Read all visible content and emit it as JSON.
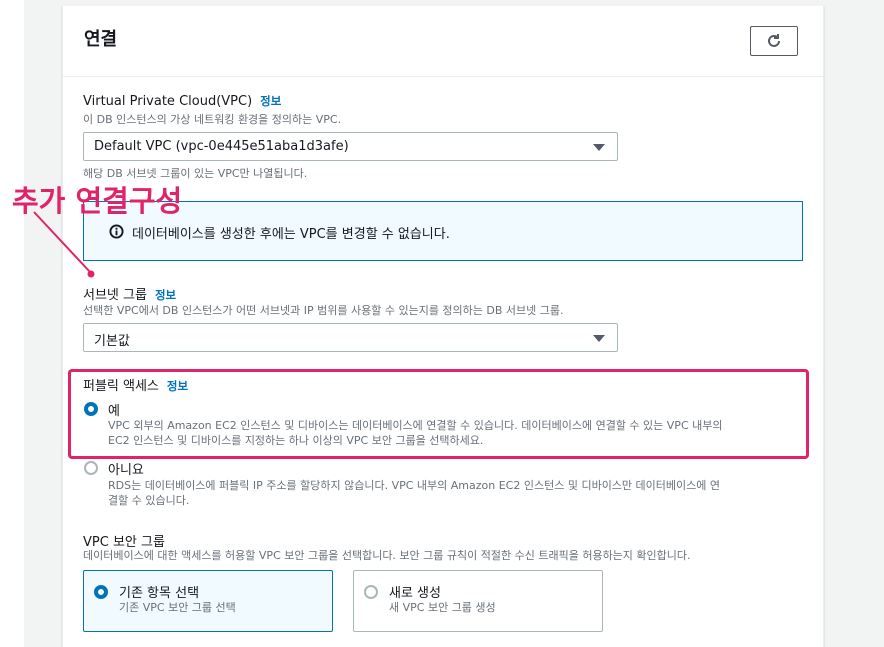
{
  "section": {
    "title": "연결",
    "refresh_icon": "refresh-icon"
  },
  "vpc": {
    "label": "Virtual Private Cloud(VPC)",
    "info": "정보",
    "description": "이 DB 인스턴스의 가상 네트워킹 환경을 정의하는 VPC.",
    "selected": "Default VPC (vpc-0e445e51aba1d3afe)",
    "hint": "해당 DB 서브넷 그룹이 있는 VPC만 나열됩니다."
  },
  "alert": {
    "icon": "info-icon",
    "text": "데이터베이스를 생성한 후에는 VPC를 변경할 수 없습니다."
  },
  "subnet": {
    "label": "서브넷 그룹",
    "info": "정보",
    "description": "선택한 VPC에서 DB 인스턴스가 어떤 서브넷과 IP 범위를 사용할 수 있는지를 정의하는 DB 서브넷 그룹.",
    "selected": "기본값"
  },
  "public_access": {
    "label": "퍼블릭 액세스",
    "info": "정보",
    "options": [
      {
        "title": "예",
        "description_line1": "VPC 외부의 Amazon EC2 인스턴스 및 디바이스는 데이터베이스에 연결할 수 있습니다. 데이터베이스에 연결할 수 있는 VPC 내부의",
        "description_line2": "EC2 인스턴스 및 디바이스를 지정하는 하나 이상의 VPC 보안 그룹을 선택하세요.",
        "checked": true
      },
      {
        "title": "아니요",
        "description_line1": "RDS는 데이터베이스에 퍼블릭 IP 주소를 할당하지 않습니다. VPC 내부의 Amazon EC2 인스턴스 및 디바이스만 데이터베이스에 연",
        "description_line2": "결할 수 있습니다.",
        "checked": false
      }
    ]
  },
  "security_group": {
    "label": "VPC 보안 그룹",
    "description": "데이터베이스에 대한 액세스를 허용할 VPC 보안 그룹을 선택합니다. 보안 그룹 규칙이 적절한 수신 트래픽을 허용하는지 확인합니다.",
    "options": [
      {
        "title": "기존 항목 선택",
        "subtitle": "기존 VPC 보안 그룹 선택",
        "checked": true
      },
      {
        "title": "새로 생성",
        "subtitle": "새 VPC 보안 그룹 생성",
        "checked": false
      }
    ]
  },
  "annotation": {
    "text": "추가 연결구성",
    "color": "#e0246a"
  },
  "colors": {
    "accent": "#0073bb",
    "annotation": "#e0246a",
    "border": "#aab7b8"
  }
}
